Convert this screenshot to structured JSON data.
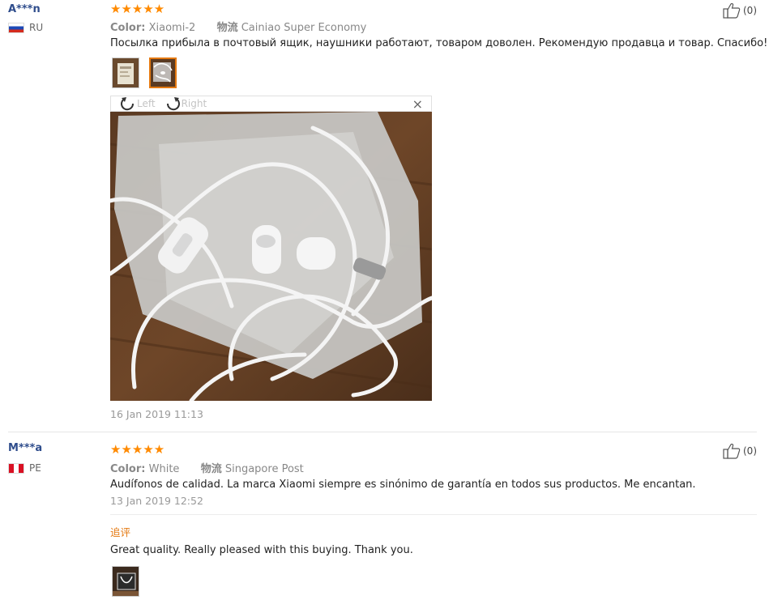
{
  "reviews": [
    {
      "user": "A***n",
      "country": "RU",
      "rating": 5,
      "stars": "★★★★★",
      "color_label": "Color:",
      "color_value": "Xiaomi-2",
      "shipping_label": "物流",
      "shipping_value": "Cainiao Super Economy",
      "text": "Посылка прибыла в почтовый ящик, наушники работают, товаром доволен. Рекомендую продавца и товар. Спасибо!!!))",
      "viewer": {
        "left_label": "Left",
        "right_label": "Right",
        "close_label": "×"
      },
      "date": "16 Jan 2019 11:13",
      "likes": "(0)"
    },
    {
      "user": "M***a",
      "country": "PE",
      "rating": 5,
      "stars": "★★★★★",
      "color_label": "Color:",
      "color_value": "White",
      "shipping_label": "物流",
      "shipping_value": "Singapore Post",
      "text": "Audífonos de calidad. La marca Xiaomi siempre es sinónimo de garantía en todos sus productos. Me encantan.",
      "date": "13 Jan 2019 12:52",
      "likes": "(0)",
      "additional": {
        "title": "追评",
        "text": "Great quality. Really pleased with this buying. Thank you."
      }
    }
  ],
  "colors": {
    "star": "#ff8a00",
    "username": "#2f4d8c",
    "accent": "#e47911"
  }
}
